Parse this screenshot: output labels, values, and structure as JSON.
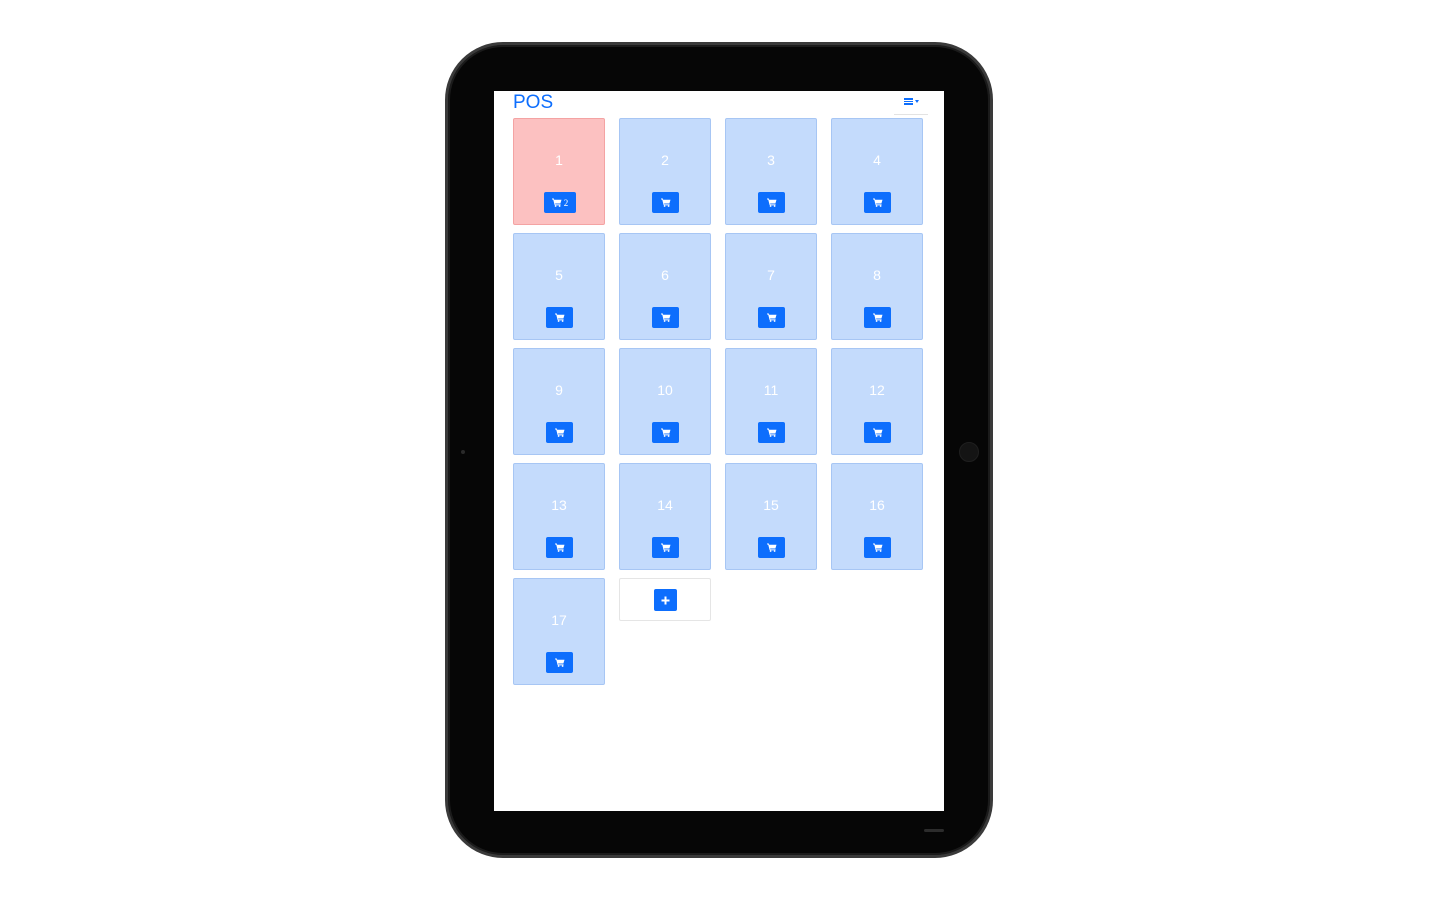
{
  "navbar": {
    "brand": "POS",
    "menu_icon": "bars-icon",
    "menu_caret_icon": "caret-down-icon"
  },
  "tables": [
    {
      "label": "1",
      "status": "occupied",
      "cart_count": "2"
    },
    {
      "label": "2",
      "status": "free",
      "cart_count": ""
    },
    {
      "label": "3",
      "status": "free",
      "cart_count": ""
    },
    {
      "label": "4",
      "status": "free",
      "cart_count": ""
    },
    {
      "label": "5",
      "status": "free",
      "cart_count": ""
    },
    {
      "label": "6",
      "status": "free",
      "cart_count": ""
    },
    {
      "label": "7",
      "status": "free",
      "cart_count": ""
    },
    {
      "label": "8",
      "status": "free",
      "cart_count": ""
    },
    {
      "label": "9",
      "status": "free",
      "cart_count": ""
    },
    {
      "label": "10",
      "status": "free",
      "cart_count": ""
    },
    {
      "label": "11",
      "status": "free",
      "cart_count": ""
    },
    {
      "label": "12",
      "status": "free",
      "cart_count": ""
    },
    {
      "label": "13",
      "status": "free",
      "cart_count": ""
    },
    {
      "label": "14",
      "status": "free",
      "cart_count": ""
    },
    {
      "label": "15",
      "status": "free",
      "cart_count": ""
    },
    {
      "label": "16",
      "status": "free",
      "cart_count": ""
    },
    {
      "label": "17",
      "status": "free",
      "cart_count": ""
    }
  ],
  "icons": {
    "cart": "shopping-cart-icon",
    "add": "plus-icon"
  },
  "colors": {
    "primary": "#0d6efd",
    "table_free": "#c4dbfc",
    "table_occupied": "#fcc1c1"
  }
}
